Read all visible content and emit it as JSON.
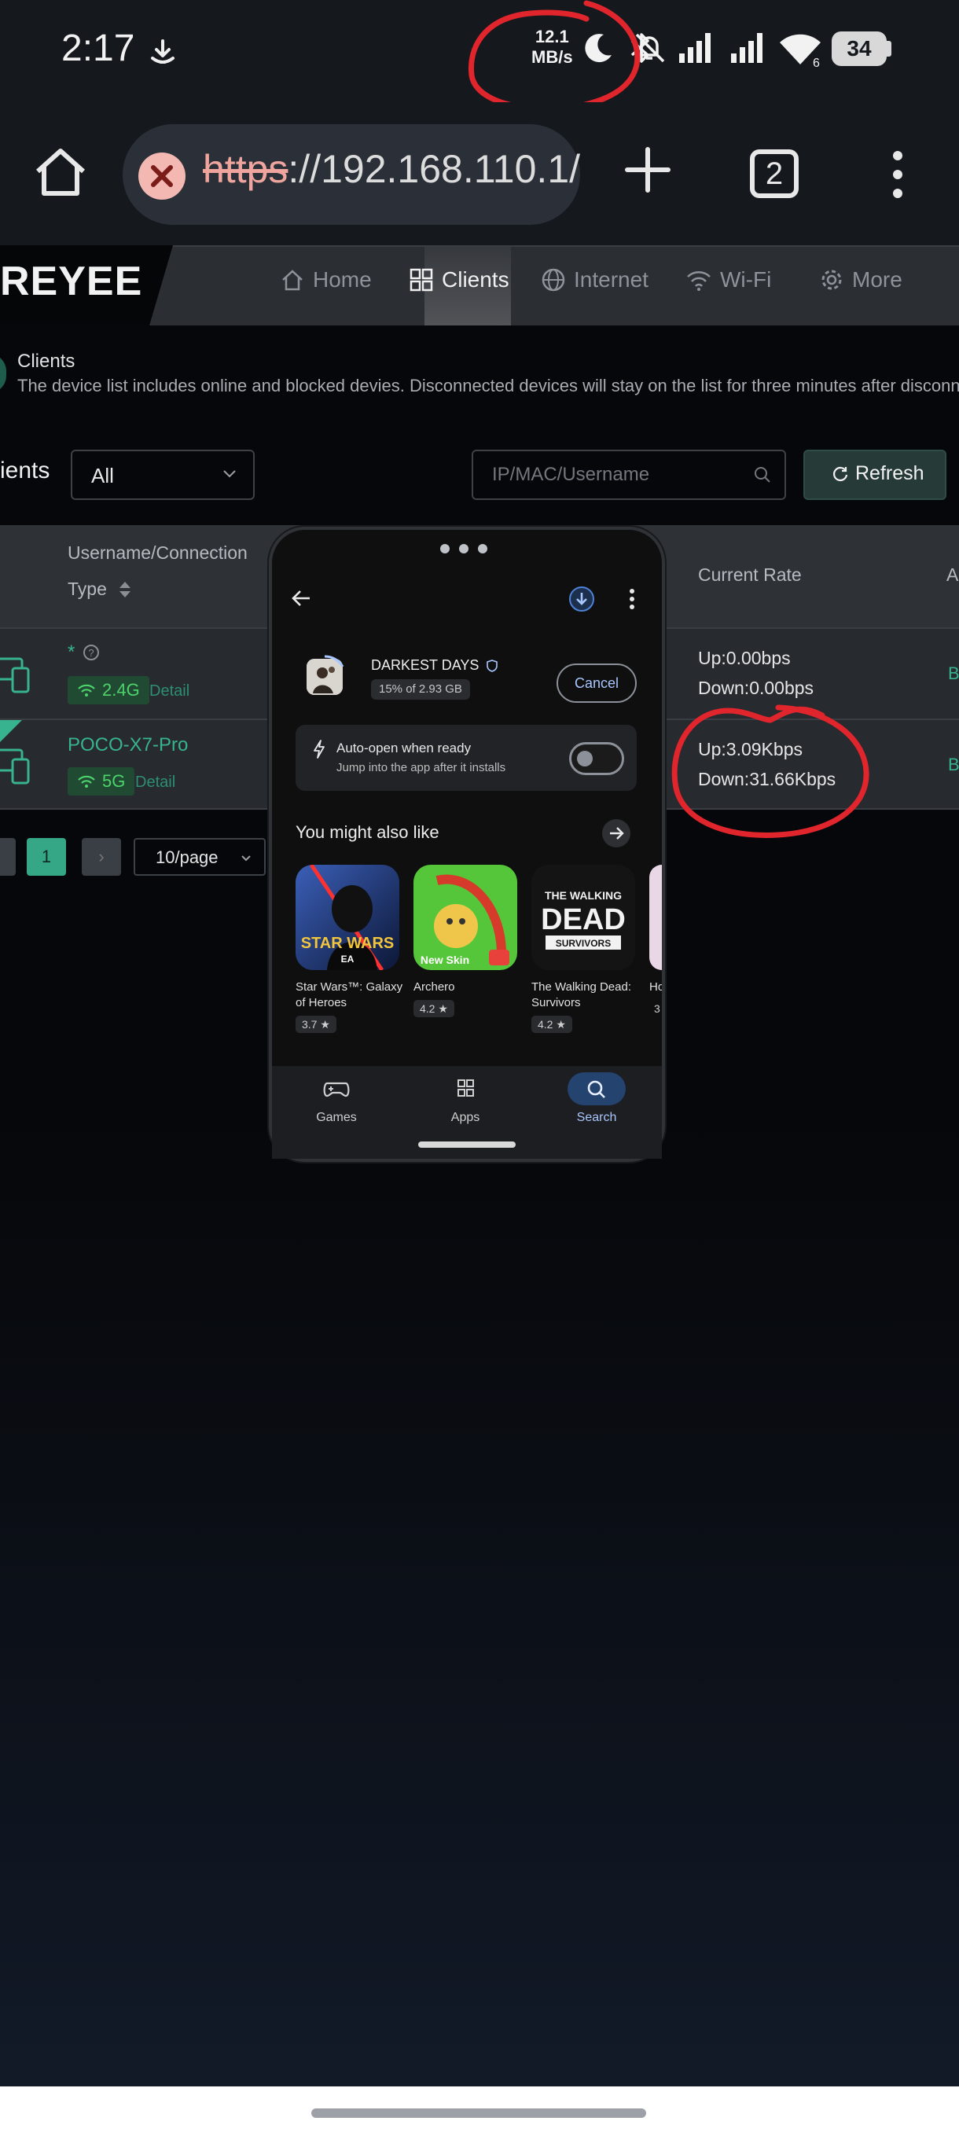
{
  "status_bar": {
    "time": "2:17",
    "net_speed_value": "12.1",
    "net_speed_unit": "MB/s",
    "signal_sub": "6",
    "battery": "34"
  },
  "browser": {
    "url_scheme": "https",
    "url_rest": "://192.168.110.1/",
    "tab_count": "2"
  },
  "router_page": {
    "logo": "REYEE",
    "nav": [
      {
        "label": "Home",
        "icon": "home-icon"
      },
      {
        "label": "Clients",
        "icon": "grid-icon",
        "active": true
      },
      {
        "label": "Internet",
        "icon": "globe-icon"
      },
      {
        "label": "Wi-Fi",
        "icon": "wifi-icon"
      },
      {
        "label": "More",
        "icon": "gear-icon"
      }
    ],
    "heading": "Clients",
    "description": "The device list includes online and blocked devies. Disconnected devices will stay on the list for three minutes after disconnect",
    "clients_label": "ients",
    "filter_value": "All",
    "search_placeholder": "IP/MAC/Username",
    "refresh_label": "Refresh",
    "table": {
      "col_username": "Username/Connection",
      "col_type": "Type",
      "col_rate": "Current Rate",
      "col_a": "A",
      "rows": [
        {
          "name": "*",
          "band": "2.4G",
          "detail": "Detail",
          "up": "Up:0.00bps",
          "down": "Down:0.00bps",
          "action": "B"
        },
        {
          "name": "POCO-X7-Pro",
          "band": "5G",
          "detail": "Detail",
          "up": "Up:3.09Kbps",
          "down": "Down:31.66Kbps",
          "action": "B"
        }
      ]
    },
    "pagination": {
      "current": "1",
      "page_size": "10/page"
    }
  },
  "play_store_overlay": {
    "app_name": "DARKEST DAYS",
    "progress": "15% of 2.93 GB",
    "cancel": "Cancel",
    "auto_open_title": "Auto-open when ready",
    "auto_open_sub": "Jump into the app after it installs",
    "recommend_title": "You might also like",
    "games": [
      {
        "name": "Star Wars™: Galaxy of Heroes",
        "rating": "3.7"
      },
      {
        "name": "Archero",
        "rating": "4.2"
      },
      {
        "name": "The Walking Dead: Survivors",
        "rating": "4.2"
      },
      {
        "name": "Ho",
        "rating": "3"
      }
    ],
    "tile_text": {
      "star_wars": "STAR WARS",
      "ea": "EA",
      "archero_badge": "New Skin",
      "twd_top": "THE WALKING",
      "twd_main": "DEAD",
      "twd_sub": "SURVIVORS"
    },
    "bottom_nav": [
      {
        "label": "Games"
      },
      {
        "label": "Apps"
      },
      {
        "label": "Search",
        "active": true
      }
    ]
  },
  "colors": {
    "accent_green": "#37b38f",
    "annotation_red": "#e0262c",
    "play_blue": "#a9c7ff"
  }
}
